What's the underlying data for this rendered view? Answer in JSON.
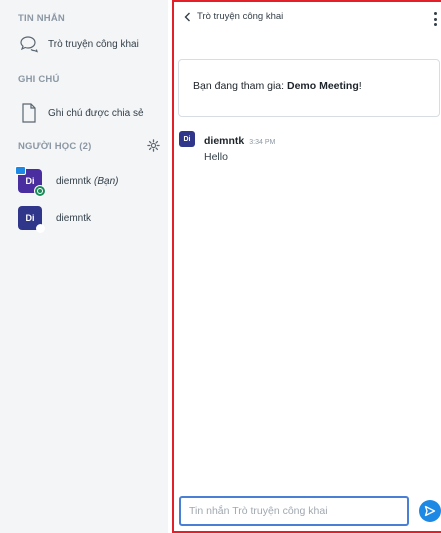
{
  "sidebar": {
    "messages_title": "TIN NHẮN",
    "public_chat_label": "Trò truyện công khai",
    "notes_title": "GHI CHÚ",
    "shared_notes_label": "Ghi chú được chia sẻ",
    "users_title": "NGƯỜI HỌC (2)",
    "users": [
      {
        "initials": "Di",
        "name": "diemntk",
        "suffix": "(Bạn)"
      },
      {
        "initials": "Di",
        "name": "diemntk"
      }
    ]
  },
  "chat": {
    "header_title": "Trò truyện công khai",
    "welcome_prefix": "Bạn đang tham gia: ",
    "meeting_name": "Demo Meeting",
    "welcome_suffix": "!",
    "messages": [
      {
        "initials": "Di",
        "author": "diemntk",
        "time": "3:34 PM",
        "text": "Hello"
      }
    ],
    "input_placeholder": "Tin nhắn Trò truyện công khai"
  },
  "colors": {
    "sidebar_bg": "#f3f5f7",
    "highlight_border": "#e2202a",
    "avatar": "#30368a",
    "send_button": "#1e88e5",
    "online_badge": "#1b8c5a"
  }
}
